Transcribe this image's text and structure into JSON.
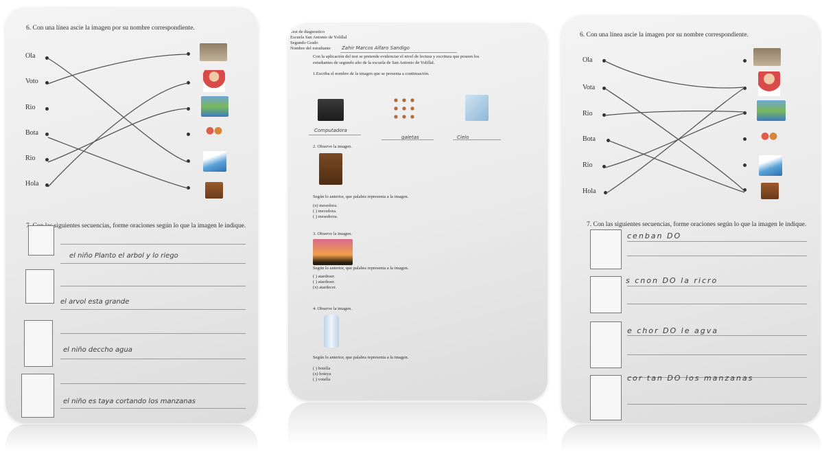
{
  "left": {
    "q6": "6. Con una línea ascie la imagen por su nombre correspondiente.",
    "words": [
      "Ola",
      "Voto",
      "Rio",
      "Bota",
      "Rio",
      "Hola"
    ],
    "q7": "7. Con las siguientes secuencias, forme oraciones según lo que la imagen le indique.",
    "answers": [
      "el niño Planto el arbol y lo riego",
      "el arvol esta grande",
      "el niño deccho agua",
      "el niño es taya cortando los manzanas"
    ]
  },
  "middle": {
    "header": [
      "Test de diagnostico",
      "Escuela San Antonio de Yolillal",
      "Segundo Grado"
    ],
    "student_label": "Nombre del estudiante",
    "student_name": "Zahir Marcos Alfaro Sandigo",
    "intro_1": "Con la aplicación del test se pretende evidenciar el nivel de lectura y escritura que poseen los",
    "intro_2": "estudiantes de segundo año de la escuela de San Antonio de Yolillal.",
    "q1": "1.Escriba el nombre de la imagen que se presenta a continuación.",
    "q1_answers": [
      "Computadora",
      "galetas",
      "Cielo"
    ],
    "q2": "2. Observe la imagen.",
    "q2_prompt": "Según lo anterior, que palabra representa a la imagen.",
    "q2_options": [
      "(x) mesedora.",
      "(  ) mecedora.",
      "(  ) mesedorra."
    ],
    "q3": "3. Observe la imagen.",
    "q3_prompt": "Según lo anterior, que palabra representa a la imagen.",
    "q3_options": [
      "(  ) atardeser.",
      "(  ) atardeser.",
      "(x) atardecer."
    ],
    "q4": "4. Observe la imagen.",
    "q4_prompt": "Según lo anterior, que palabra representa a la imagen.",
    "q4_options": [
      "(  ) botella",
      "(x) boteya",
      "(  ) votella"
    ]
  },
  "right": {
    "q6": "6. Con una línea ascie la imagen por su nombre correspondiente.",
    "words": [
      "Ola",
      "Vota",
      "Rio",
      "Bota",
      "Rio",
      "Hola"
    ],
    "q7": "7. Con las siguientes secuencias, forme oraciones según lo que la imagen le indique.",
    "answers": [
      "cenban DO",
      "s cnon DO la ricro",
      "e chor DO le agva",
      "cor tan DO los manzanas"
    ]
  },
  "colors": {
    "page": "#ffffff",
    "sheet": "#ececec",
    "ink": "#2e2e2e"
  }
}
